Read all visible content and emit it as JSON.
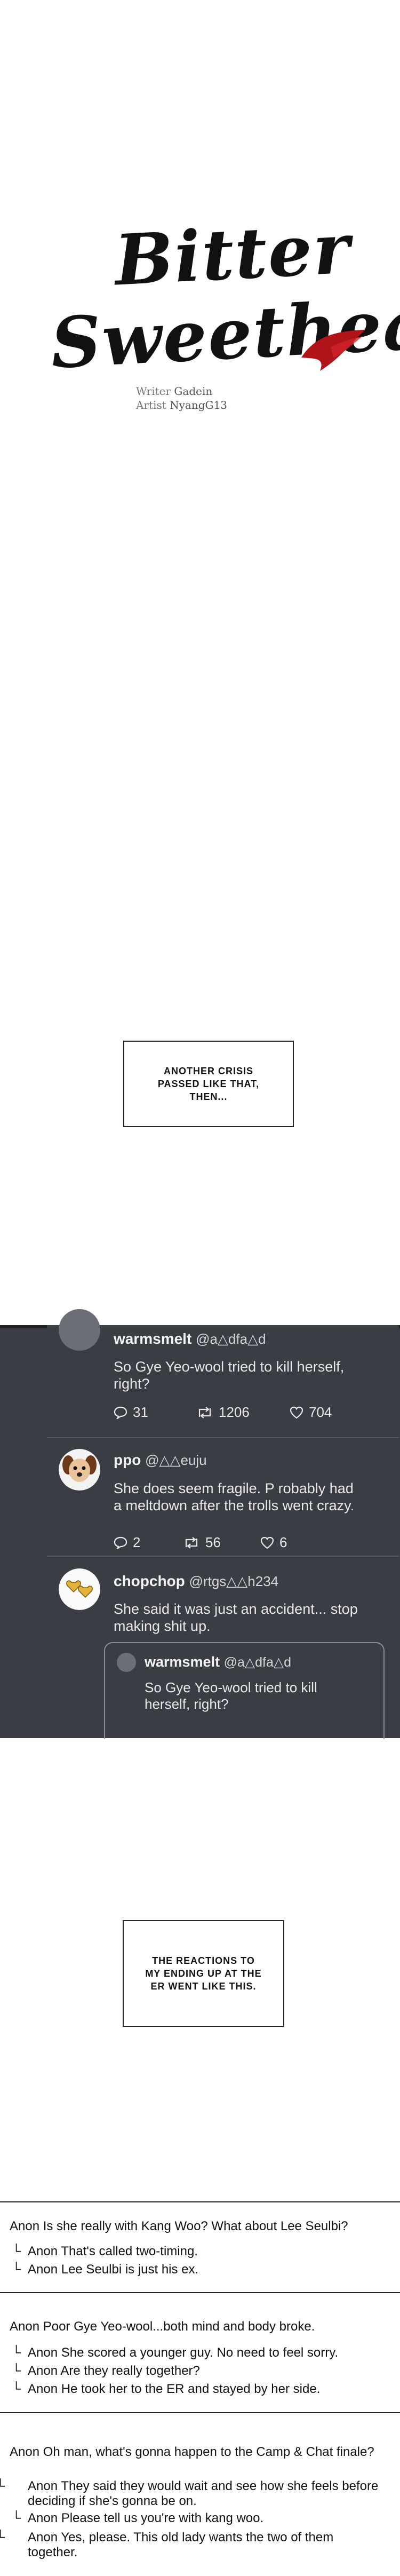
{
  "title": {
    "line1": "Bitter",
    "line2": "Sweetheart"
  },
  "credits": {
    "writer_label": "Writer",
    "writer": "Gadein",
    "artist_label": "Artist",
    "artist": "NyangG13"
  },
  "captions": {
    "first": "ANOTHER CRISIS PASSED LIKE THAT, THEN...",
    "second": "THE REACTIONS TO MY ENDING UP AT THE ER WENT LIKE THIS."
  },
  "feed": {
    "posts": [
      {
        "user": "warmsmelt",
        "handle": "@a△dfa△d",
        "text": "So Gye Yeo-wool tried to kill herself, right?",
        "replies": "31",
        "reposts": "1206",
        "likes": "704"
      },
      {
        "user": "ppo",
        "handle": "@△△euju",
        "text": "She does seem fragile. P robably had a meltdown after the trolls went crazy.",
        "replies": "2",
        "reposts": "56",
        "likes": "6"
      },
      {
        "user": "chopchop",
        "handle": "@rtgs△△h234",
        "text": "She said it was just an accident... stop making shit up."
      }
    ],
    "quoted": {
      "user": "warmsmelt",
      "handle": "@a△dfa△d",
      "text": "So Gye Yeo-wool tried to kill herself, right?"
    }
  },
  "comments": [
    {
      "text": "Anon Is she really with Kang Woo? What about Lee Seulbi?",
      "replies": [
        "Anon That's called two-timing.",
        "Anon Lee Seulbi is just his ex."
      ]
    },
    {
      "text": "Anon Poor Gye Yeo-wool...both mind and body broke.",
      "replies": [
        "Anon She scored a younger guy. No need to feel sorry.",
        "Anon Are they really together?",
        "Anon He took her to the ER and stayed by her side."
      ]
    },
    {
      "text": "Anon Oh man, what's gonna happen to the Camp & Chat finale?",
      "replies": [
        "Anon They said they would wait and see how she feels before deciding if she's gonna be on.",
        "Anon Please tell us you're with kang woo.",
        "Anon Yes, please. This old lady wants the two of them together."
      ]
    }
  ],
  "colors": {
    "panel": "#3a3d44",
    "title_accent": "#b0141a"
  },
  "icons": [
    "comment-icon",
    "repost-icon",
    "heart-icon",
    "avatar-dog",
    "avatar-heart-emblem"
  ]
}
